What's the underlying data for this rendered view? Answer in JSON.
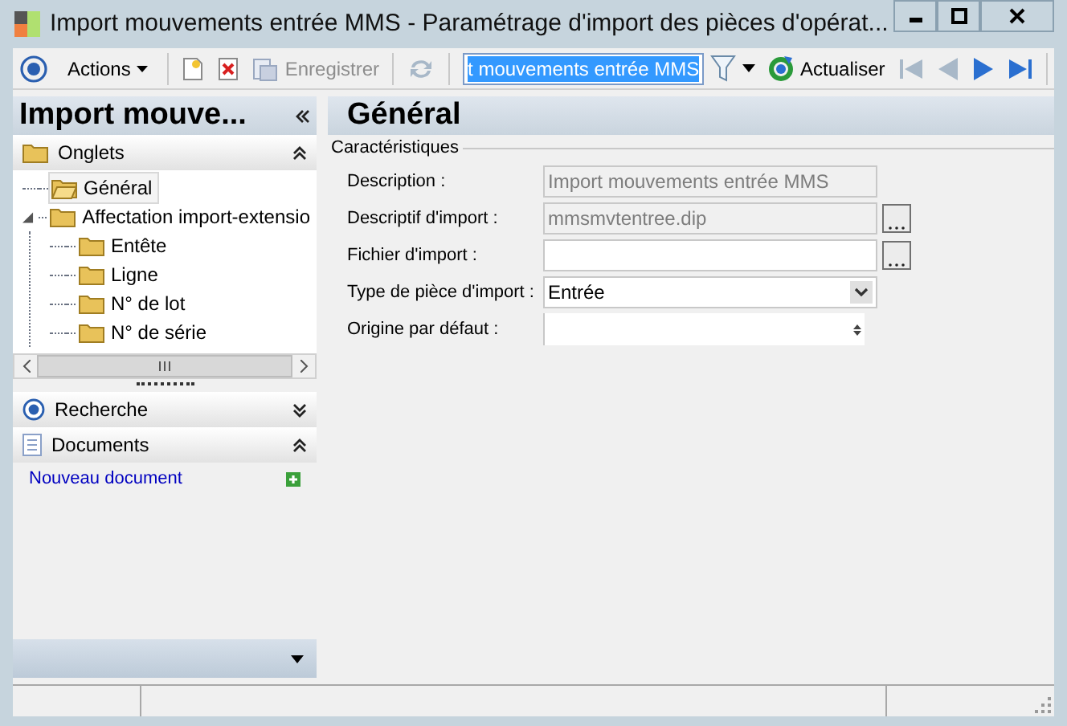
{
  "window": {
    "title": "Import mouvements entrée MMS -  Paramétrage d'import des pièces d'opérat..."
  },
  "toolbar": {
    "items": [
      {
        "kind": "target",
        "disabled": false
      },
      {
        "kind": "menu",
        "label": "Actions",
        "disabled": false
      },
      {
        "kind": "new",
        "disabled": false
      },
      {
        "kind": "delete",
        "disabled": false
      },
      {
        "kind": "save",
        "label": "Enregistrer",
        "disabled": true
      },
      {
        "kind": "refresh",
        "disabled": true
      },
      {
        "kind": "search",
        "value": "t mouvements entrée MMS"
      },
      {
        "kind": "filter",
        "disabled": false
      },
      {
        "kind": "refresh-labeled",
        "label": "Actualiser",
        "disabled": false
      },
      {
        "kind": "first",
        "disabled": true
      },
      {
        "kind": "prev",
        "disabled": true
      },
      {
        "kind": "next",
        "disabled": false
      },
      {
        "kind": "last",
        "disabled": false
      }
    ]
  },
  "sidebar": {
    "title": "Import mouve...",
    "sections": [
      {
        "kind": "tabs",
        "label": "Onglets",
        "expanded": true,
        "tree": [
          {
            "label": "Général",
            "selected": true
          },
          {
            "label": "Affectation import-extensio",
            "selected": false,
            "expanded": true,
            "children": [
              {
                "label": "Entête",
                "selected": false
              },
              {
                "label": "Ligne",
                "selected": false
              },
              {
                "label": "N° de lot",
                "selected": false
              },
              {
                "label": "N° de série",
                "selected": false
              }
            ]
          }
        ]
      },
      {
        "kind": "search",
        "label": "Recherche",
        "expanded": false
      },
      {
        "kind": "documents",
        "label": "Documents",
        "expanded": true,
        "links": [
          "Nouveau document"
        ]
      }
    ]
  },
  "content": {
    "title": "Général",
    "group": "Caractéristiques",
    "fields": [
      {
        "kind": "text",
        "label": "Description :",
        "value": "Import mouvements entrée MMS",
        "disabled": true
      },
      {
        "kind": "browse",
        "label": "Descriptif d'import :",
        "value": "mmsmvtentree.dip",
        "disabled": true
      },
      {
        "kind": "browse",
        "label": "Fichier d'import :",
        "disabled": false
      },
      {
        "kind": "select",
        "label": "Type de pièce d'import :",
        "value": "Entrée",
        "disabled": false
      },
      {
        "kind": "spin",
        "label": "Origine par défaut :",
        "disabled": false
      }
    ]
  }
}
